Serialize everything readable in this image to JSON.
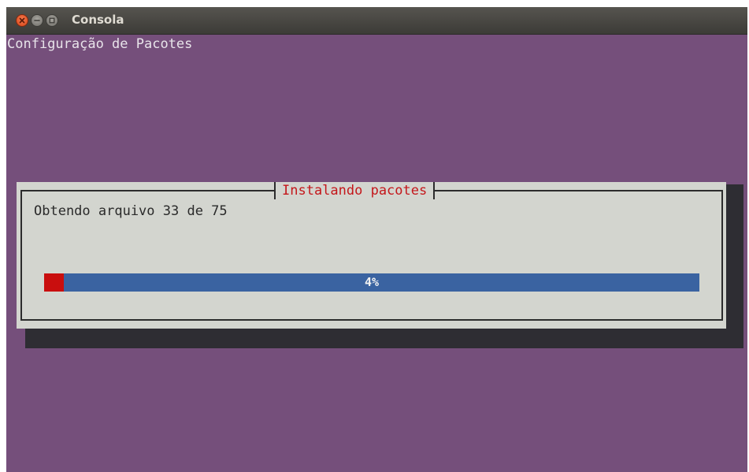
{
  "window": {
    "title": "Consola",
    "controls": [
      "close-icon",
      "minimize-icon",
      "maximize-icon"
    ]
  },
  "terminal": {
    "heading": "Configuração de Pacotes"
  },
  "dialog": {
    "title": "Instalando pacotes",
    "status": "Obtendo arquivo 33 de 75",
    "progress": {
      "fraction": 0.03,
      "label": "4%"
    }
  },
  "colors": {
    "terminal_background": "#754f7b",
    "dialog_background": "#d3d5cf",
    "dialog_title": "#c4171b",
    "progress_track": "#3a63a1",
    "progress_fill": "#c90e0e"
  }
}
